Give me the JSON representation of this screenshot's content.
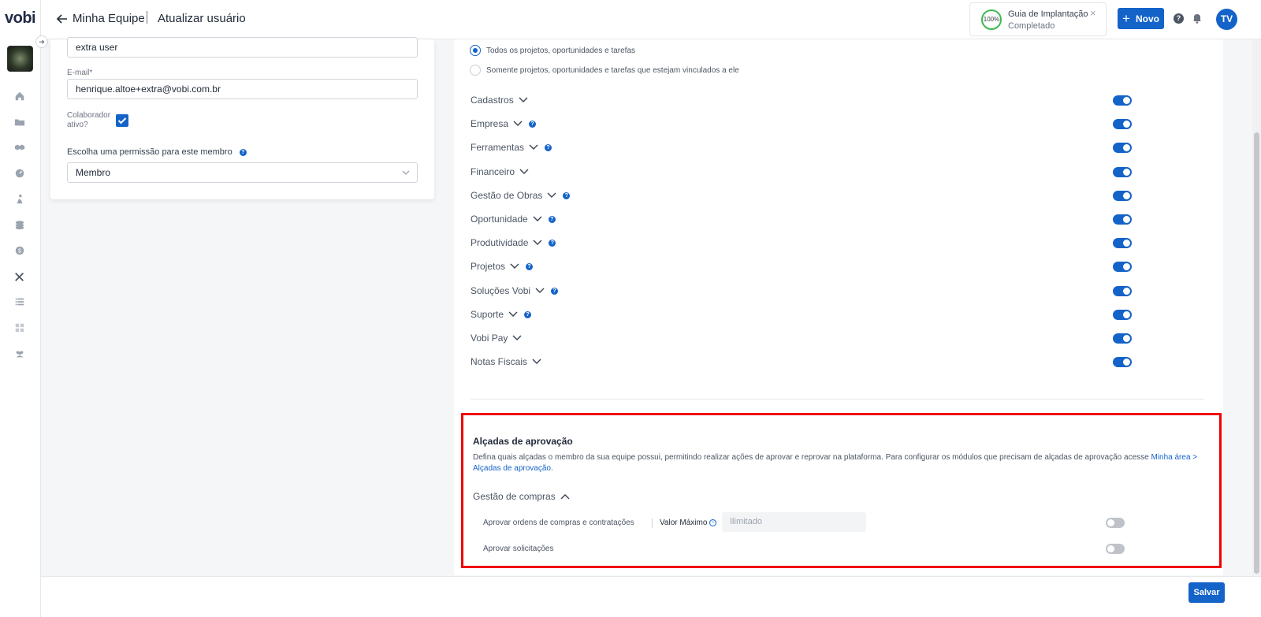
{
  "sidebar": {
    "logo": "vobi",
    "collapse_icon": "arrow-right-icon",
    "items": [
      {
        "icon": "home-icon"
      },
      {
        "icon": "folder-icon"
      },
      {
        "icon": "handshake-icon"
      },
      {
        "icon": "gauge-icon"
      },
      {
        "icon": "worker-icon"
      },
      {
        "icon": "coins-icon"
      },
      {
        "icon": "dollar-icon"
      },
      {
        "icon": "tools-icon"
      },
      {
        "icon": "list-icon"
      },
      {
        "icon": "grid-icon"
      },
      {
        "icon": "team-icon"
      }
    ]
  },
  "header": {
    "breadcrumb_parent": "Minha Equipe",
    "breadcrumb_current": "Atualizar usuário",
    "guide": {
      "percent": "100%",
      "title": "Guia de Implantação",
      "status": "Completado",
      "close": "×"
    },
    "new_button": "Novo",
    "new_plus": "+",
    "help": "?",
    "avatar_initials": "TV"
  },
  "form": {
    "name_value": "extra user",
    "email_label": "E-mail*",
    "email_value": "henrique.altoe+extra@vobi.com.br",
    "active_label_line1": "Colaborador",
    "active_label_line2": "ativo?",
    "active_checked": true,
    "permission_label": "Escolha uma permissão para este membro",
    "permission_value": "Membro"
  },
  "visibility": {
    "option_all": "Todos os projetos, oportunidades e tarefas",
    "option_linked": "Somente projetos, oportunidades e tarefas que estejam vinculados a ele",
    "selected": "all"
  },
  "modules": [
    {
      "label": "Cadastros",
      "help": false,
      "enabled": true
    },
    {
      "label": "Empresa",
      "help": true,
      "enabled": true
    },
    {
      "label": "Ferramentas",
      "help": true,
      "enabled": true
    },
    {
      "label": "Financeiro",
      "help": false,
      "enabled": true
    },
    {
      "label": "Gestão de Obras",
      "help": true,
      "enabled": true
    },
    {
      "label": "Oportunidade",
      "help": true,
      "enabled": true
    },
    {
      "label": "Produtividade",
      "help": true,
      "enabled": true
    },
    {
      "label": "Projetos",
      "help": true,
      "enabled": true
    },
    {
      "label": "Soluções Vobi",
      "help": true,
      "enabled": true
    },
    {
      "label": "Suporte",
      "help": true,
      "enabled": true
    },
    {
      "label": "Vobi Pay",
      "help": false,
      "enabled": true
    },
    {
      "label": "Notas Fiscais",
      "help": false,
      "enabled": true
    }
  ],
  "approval": {
    "title": "Alçadas de aprovação",
    "description": "Defina quais alçadas o membro da sua equipe possui, permitindo realizar ações de aprovar e reprovar na plataforma. Para configurar os módulos que precisam de alçadas de aprovação acesse ",
    "link_text": "Minha área > Alçadas de aprovação",
    "description_end": ".",
    "section": "Gestão de compras",
    "items": [
      {
        "label": "Aprovar ordens de compras e contratações",
        "enabled": false
      },
      {
        "label": "Aprovar solicitações",
        "enabled": false
      }
    ],
    "max_label": "Valor Máximo",
    "max_placeholder": "Ilimitado",
    "highlight_color": "#ef0000"
  },
  "footer": {
    "save_button": "Salvar"
  },
  "colors": {
    "primary": "#1463c9",
    "toggle_off": "#bfc3c9"
  }
}
